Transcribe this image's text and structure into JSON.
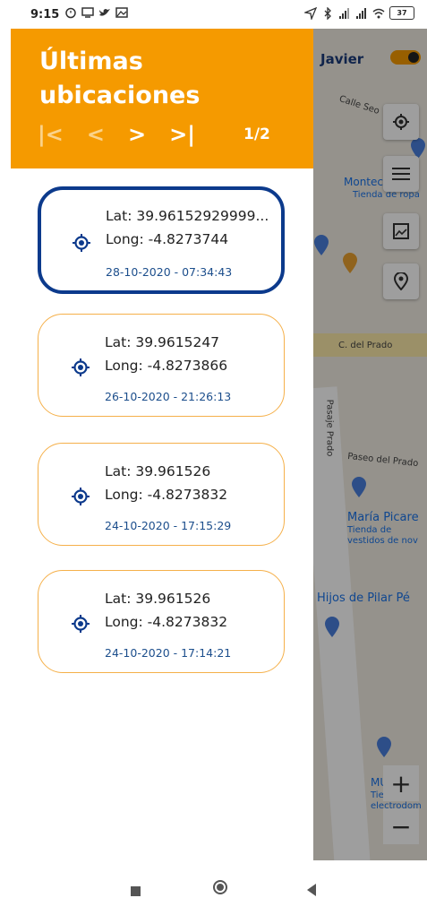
{
  "status_bar": {
    "time": "9:15",
    "battery": "37"
  },
  "drawer": {
    "title": "Últimas ubicaciones",
    "pager": {
      "first": "|<",
      "prev": "<",
      "next": ">",
      "last": ">|",
      "page": "1/2"
    },
    "locations": [
      {
        "lat": "Lat: 39.96152929999...",
        "long": "Long: -4.8273744",
        "date": "28-10-2020 - 07:34:43",
        "selected": true
      },
      {
        "lat": "Lat: 39.9615247",
        "long": "Long: -4.8273866",
        "date": "26-10-2020 - 21:26:13",
        "selected": false
      },
      {
        "lat": "Lat: 39.961526",
        "long": "Long: -4.8273832",
        "date": "24-10-2020 - 17:15:29",
        "selected": false
      },
      {
        "lat": "Lat: 39.961526",
        "long": "Long: -4.8273832",
        "date": "24-10-2020 - 17:14:21",
        "selected": false
      }
    ]
  },
  "map": {
    "user": "Javier",
    "labels": {
      "street_top": "Calle Seo",
      "monte": "Montecillazo",
      "monte_sub": "Tienda de ropa",
      "prado": "C. del Prado",
      "prado_vertical": "Pasaje Prado",
      "paseo": "Paseo del Prado",
      "maria": "María Picare",
      "maria_sub1": "Tienda de",
      "maria_sub2": "vestidos de nov",
      "hijos": "Hijos de Pilar Pé",
      "mu": "MU",
      "mu_sub1": "Tienda de",
      "mu_sub2": "electrodom"
    }
  },
  "colors": {
    "accent": "#f59a00",
    "selected_border": "#0c3a8c",
    "date_text": "#1c4e8c",
    "card_border": "#f5b04a"
  }
}
